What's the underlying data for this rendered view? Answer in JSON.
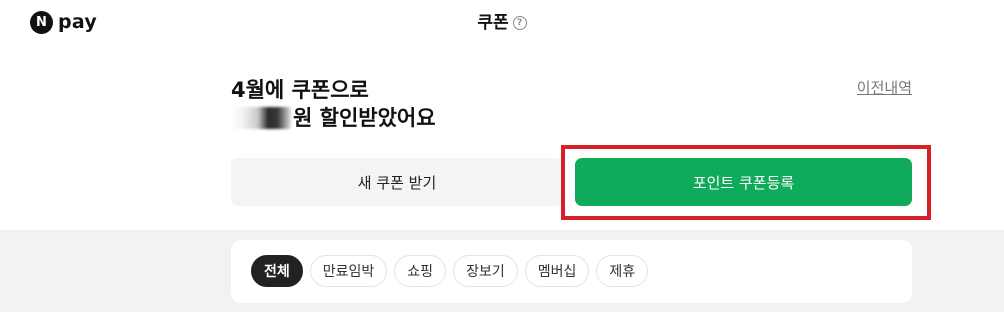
{
  "header": {
    "logo_mark": "N",
    "logo_text": "pay",
    "title": "쿠폰",
    "help_icon": "?"
  },
  "summary": {
    "line1": "4월에 쿠폰으로",
    "line2_suffix": "원 할인받았어요"
  },
  "history_link": "이전내역",
  "actions": {
    "new_coupon_label": "새 쿠폰 받기",
    "register_label": "포인트 쿠폰등록"
  },
  "filters": [
    {
      "label": "전체",
      "active": true
    },
    {
      "label": "만료임박",
      "active": false
    },
    {
      "label": "쇼핑",
      "active": false
    },
    {
      "label": "장보기",
      "active": false
    },
    {
      "label": "멤버십",
      "active": false
    },
    {
      "label": "제휴",
      "active": false
    }
  ],
  "colors": {
    "accent_green": "#0fab5b",
    "highlight_red": "#d72027",
    "active_chip": "#222222"
  }
}
